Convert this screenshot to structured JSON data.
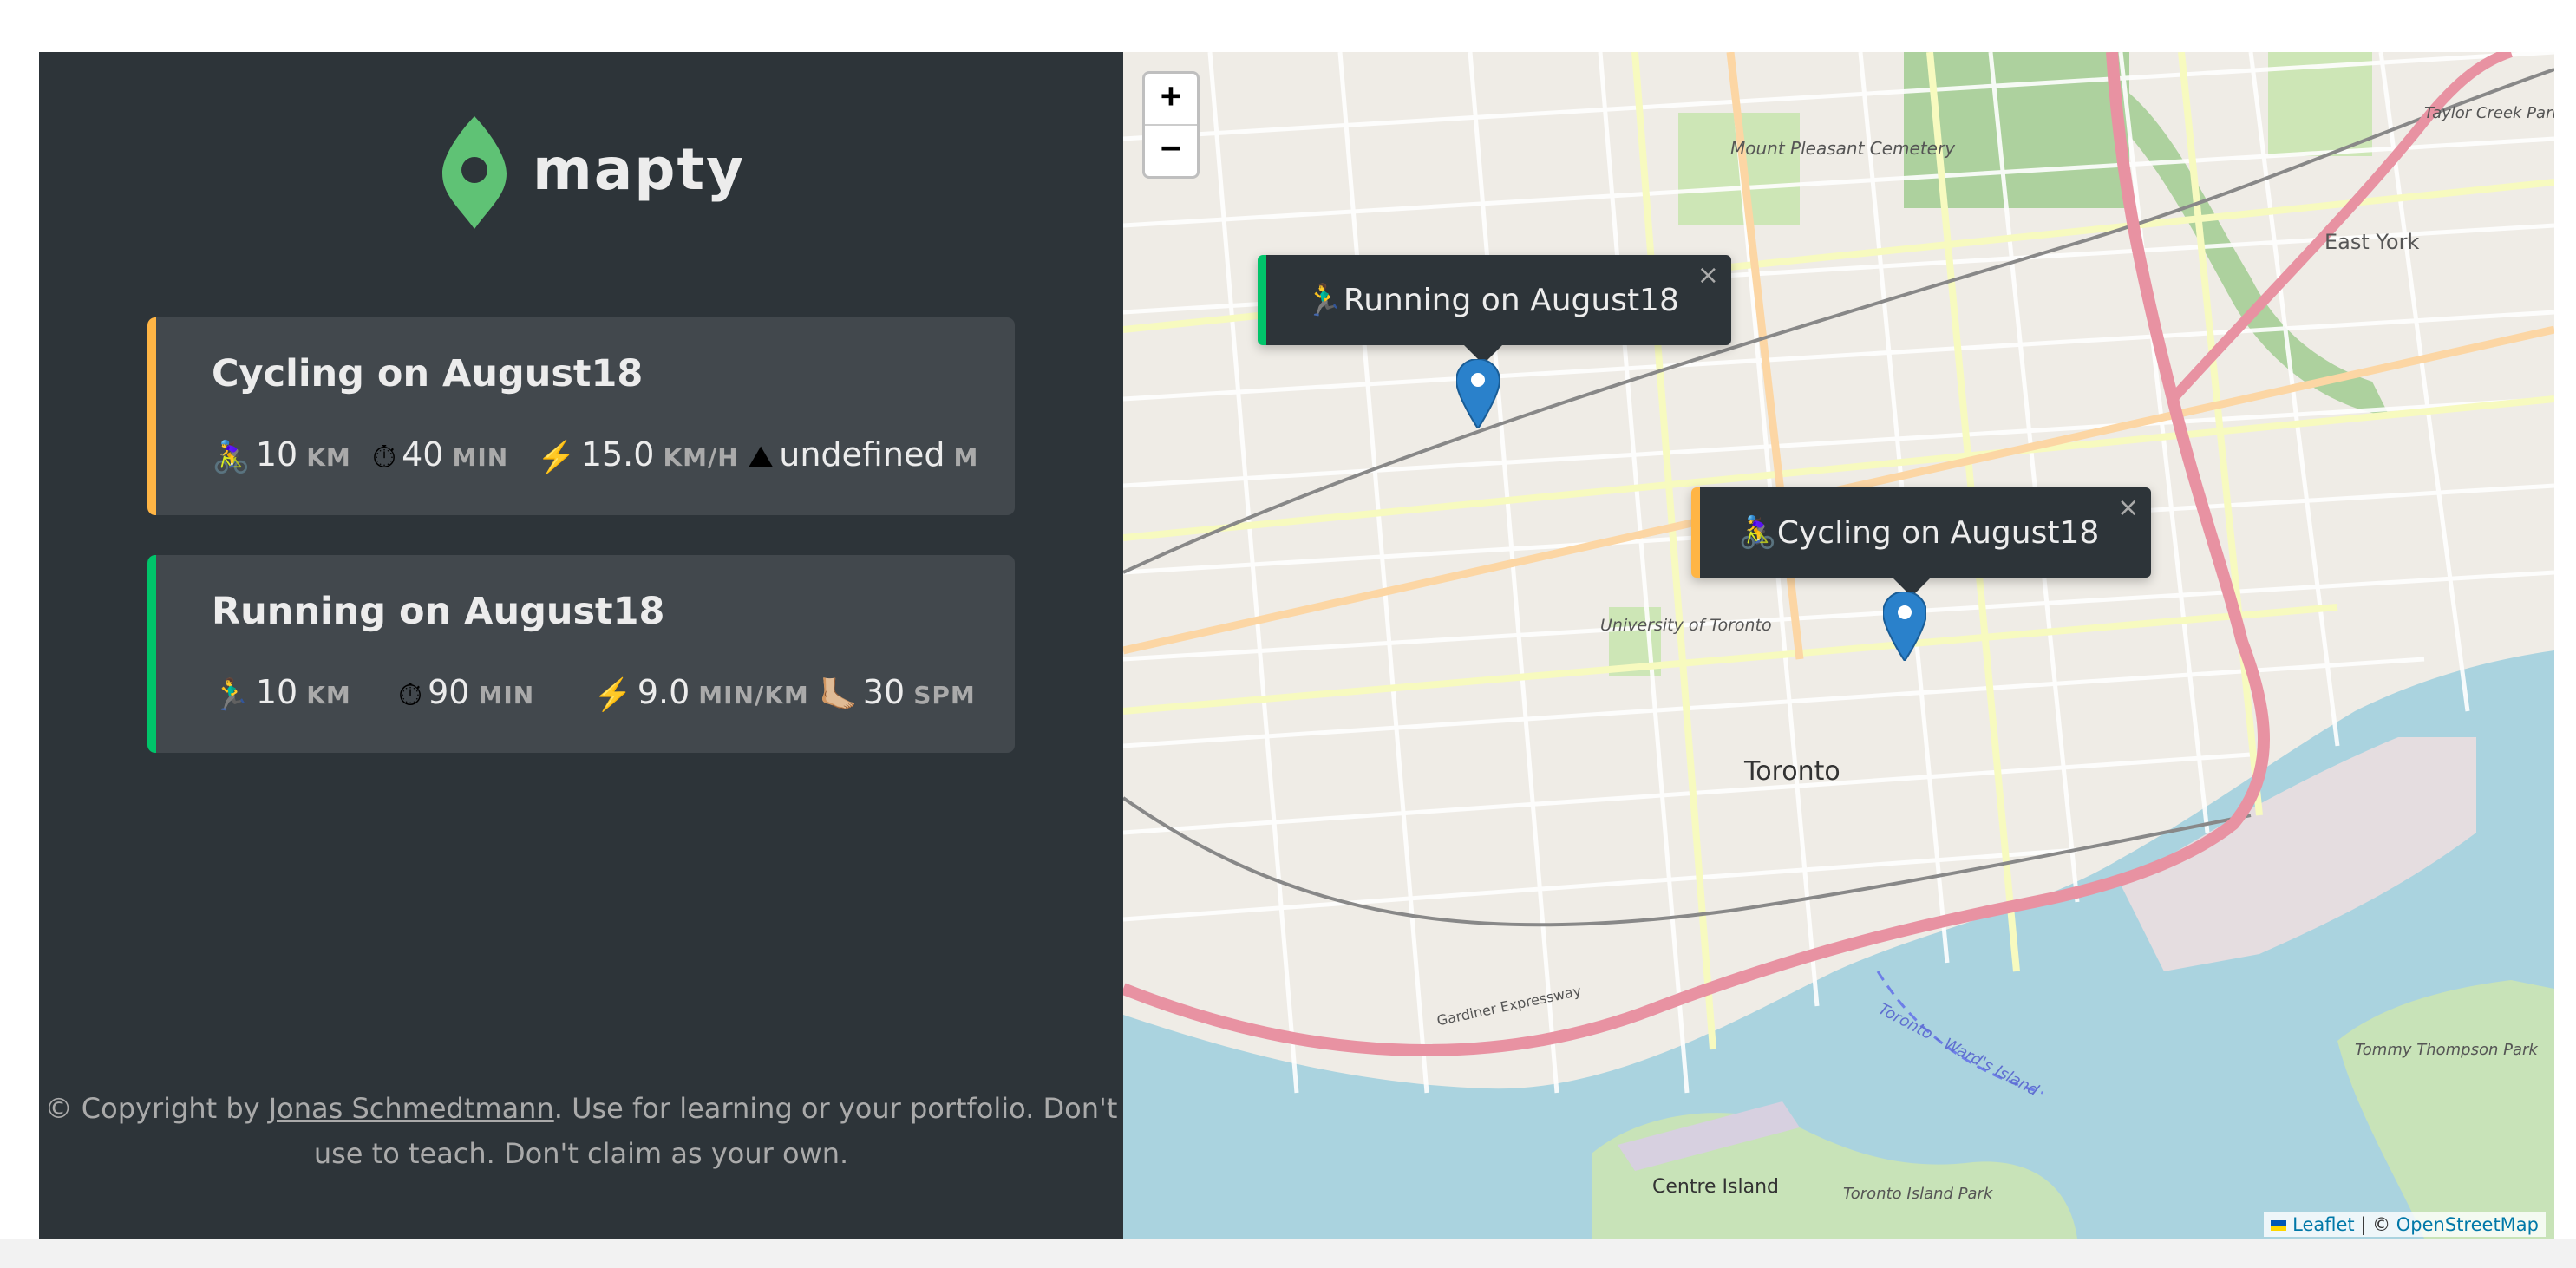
{
  "brand": {
    "name": "mapty",
    "accent": "#00c46a"
  },
  "colors": {
    "sidebar_bg": "#2d3439",
    "card_bg": "#42484d",
    "cycling": "#ffb545",
    "running": "#00c46a"
  },
  "workouts": [
    {
      "type": "cycling",
      "title": "Cycling on August18",
      "details": [
        {
          "icon": "🚴‍♀️",
          "icon_name": "cyclist-icon",
          "value": "10",
          "unit": "km"
        },
        {
          "icon": "⏱",
          "icon_name": "stopwatch-icon",
          "value": "40",
          "unit": "min"
        },
        {
          "icon": "⚡️",
          "icon_name": "lightning-icon",
          "value": "15.0",
          "unit": "km/h"
        },
        {
          "icon": "⛰",
          "icon_name": "mountain-icon",
          "value": "undefined",
          "unit": "m"
        }
      ]
    },
    {
      "type": "running",
      "title": "Running on August18",
      "details": [
        {
          "icon": "🏃‍♂️",
          "icon_name": "runner-icon",
          "value": "10",
          "unit": "km"
        },
        {
          "icon": "⏱",
          "icon_name": "stopwatch-icon",
          "value": "90",
          "unit": "min"
        },
        {
          "icon": "⚡️",
          "icon_name": "lightning-icon",
          "value": "9.0",
          "unit": "min/km"
        },
        {
          "icon": "🦶🏼",
          "icon_name": "footprint-icon",
          "value": "30",
          "unit": "spm"
        }
      ]
    }
  ],
  "copyright": {
    "prefix": "© Copyright by ",
    "author": "Jonas Schmedtmann",
    "suffix": ". Use for learning or your portfolio. Don't use to teach. Don't claim as your own."
  },
  "map": {
    "zoom_in": "+",
    "zoom_out": "−",
    "popups": [
      {
        "type": "running",
        "icon": "🏃‍♂️",
        "text": "Running on August18",
        "close": "×"
      },
      {
        "type": "cycling",
        "icon": "🚴‍♀️",
        "text": "Cycling on August18",
        "close": "×"
      }
    ],
    "labels": {
      "toronto": "Toronto",
      "east_york": "East York",
      "mount_pleasant": "Mount Pleasant Cemetery",
      "university": "University of Toronto",
      "centre_island": "Centre Island",
      "toronto_island_park": "Toronto Island Park",
      "tommy_thompson": "Tommy Thompson Park",
      "taylor_creek": "Taylor Creek Park",
      "ferry": "Toronto - Ward's Island",
      "gardiner": "Gardiner Expressway"
    },
    "attribution": {
      "leaflet": "Leaflet",
      "separator": " | © ",
      "osm": "OpenStreetMap"
    }
  }
}
